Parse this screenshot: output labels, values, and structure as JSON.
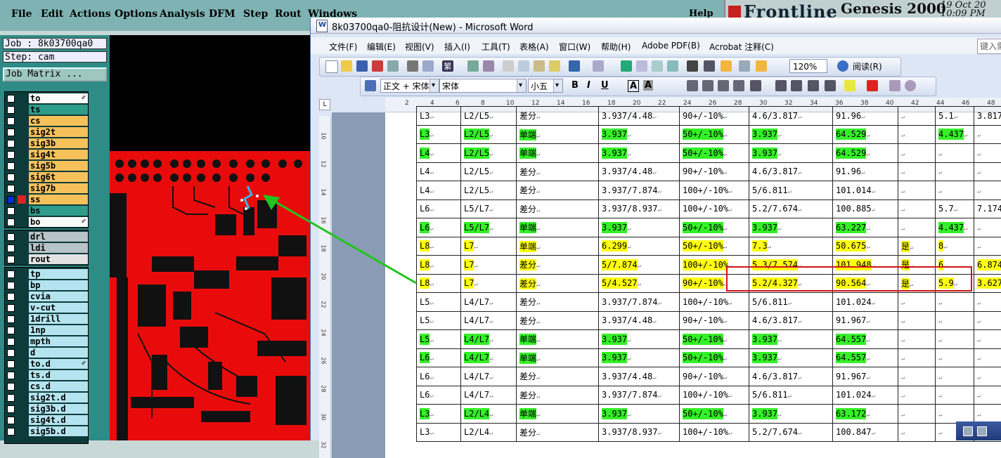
{
  "genesis": {
    "menu": [
      "File",
      "Edit",
      "Actions",
      "Options",
      "Analysis",
      "DFM",
      "Step",
      "Rout",
      "Windows"
    ],
    "help": "Help",
    "brand": "Frontline",
    "product": "Genesis 2000",
    "date_line1": "19 Oct 20",
    "date_line2": "10:09 PM",
    "job_label": "Job : 8k03700qa0",
    "step_label": "Step: cam",
    "job_matrix_button": "Job Matrix ...",
    "layers_group1": [
      {
        "name": "to",
        "color": "white",
        "mark": "brush"
      },
      {
        "name": "ts",
        "color": "teal"
      },
      {
        "name": "cs",
        "color": "orange"
      },
      {
        "name": "sig2t",
        "color": "orange"
      },
      {
        "name": "sig3b",
        "color": "orange"
      },
      {
        "name": "sig4t",
        "color": "orange"
      },
      {
        "name": "sig5b",
        "color": "orange"
      },
      {
        "name": "sig6t",
        "color": "orange"
      },
      {
        "name": "sig7b",
        "color": "orange"
      },
      {
        "name": "ss",
        "color": "orange",
        "active": true
      },
      {
        "name": "bs",
        "color": "teal"
      },
      {
        "name": "bo",
        "color": "white",
        "mark": "brush"
      }
    ],
    "layers_group2": [
      {
        "name": "drl",
        "color": "gray"
      },
      {
        "name": "ldi",
        "color": "gray"
      },
      {
        "name": "rout",
        "color": "lgray"
      }
    ],
    "layers_group3": [
      {
        "name": "tp"
      },
      {
        "name": "bp"
      },
      {
        "name": "cvia"
      },
      {
        "name": "v-cut"
      },
      {
        "name": "1drill"
      },
      {
        "name": "1np"
      },
      {
        "name": "mpth"
      },
      {
        "name": "d"
      },
      {
        "name": "to.d",
        "mark": "brush"
      },
      {
        "name": "ts.d"
      },
      {
        "name": "cs.d"
      },
      {
        "name": "sig2t.d"
      },
      {
        "name": "sig3b.d"
      },
      {
        "name": "sig4t.d"
      },
      {
        "name": "sig5b.d"
      }
    ]
  },
  "word": {
    "window_title": "8k03700qa0-阻抗设计(New) - Microsoft Word",
    "menu": [
      "文件(F)",
      "编辑(E)",
      "视图(V)",
      "插入(I)",
      "工具(T)",
      "表格(A)",
      "窗口(W)",
      "帮助(H)",
      "Adobe PDF(B)",
      "Acrobat 注释(C)"
    ],
    "ask_box": "键入需",
    "zoom": "120%",
    "read_button": "阅读(R)",
    "style_box": "正文 + 宋体",
    "font_box": "宋体",
    "size_box": "小五",
    "ruler_numbers": [
      "2",
      "4",
      "6",
      "8",
      "10",
      "12",
      "14",
      "16",
      "18",
      "20",
      "22",
      "24",
      "26",
      "28",
      "30",
      "32",
      "34",
      "36",
      "38",
      "40",
      "42",
      "44",
      "46",
      "48"
    ],
    "vruler_numbers": [
      "10",
      "12",
      "14",
      "16",
      "18",
      "20",
      "22",
      "24",
      "26",
      "28",
      "30",
      "32"
    ],
    "table_rows": [
      {
        "cells": [
          "L3",
          "L2/L5",
          "差分",
          "3.937/4.48",
          "90+/-10%",
          "4.6/3.817",
          "91.96",
          "",
          "5.1",
          "3.817"
        ],
        "hl": []
      },
      {
        "cells": [
          "L3",
          "L2/L5",
          "单端",
          "3.937",
          "50+/-10%",
          "3.937",
          "64.529",
          "",
          "4.437",
          ""
        ],
        "hl": [
          "g",
          "g",
          "g",
          "g",
          "g",
          "g",
          "g",
          "",
          "g",
          ""
        ]
      },
      {
        "cells": [
          "L4",
          "L2/L5",
          "单端",
          "3.937",
          "50+/-10%",
          "3.937",
          "64.529",
          "",
          "",
          ""
        ],
        "hl": [
          "g",
          "g",
          "g",
          "g",
          "g",
          "g",
          "g",
          "",
          "",
          ""
        ]
      },
      {
        "cells": [
          "L4",
          "L2/L5",
          "差分",
          "3.937/4.48",
          "90+/-10%",
          "4.6/3.817",
          "91.96",
          "",
          "",
          ""
        ],
        "hl": []
      },
      {
        "cells": [
          "L4",
          "L2/L5",
          "差分",
          "3.937/7.874",
          "100+/-10%",
          "5/6.811",
          "101.014",
          "",
          "",
          ""
        ],
        "hl": []
      },
      {
        "cells": [
          "L6",
          "L5/L7",
          "差分",
          "3.937/8.937",
          "100+/-10%",
          "5.2/7.674",
          "100.885",
          "",
          "5.7",
          "7.174"
        ],
        "hl": []
      },
      {
        "cells": [
          "L6",
          "L5/L7",
          "单端",
          "3.937",
          "50+/-10%",
          "3.937",
          "63.227",
          "",
          "4.437",
          ""
        ],
        "hl": [
          "g",
          "g",
          "g",
          "g",
          "g",
          "g",
          "g",
          "",
          "g",
          ""
        ]
      },
      {
        "cells": [
          "L8",
          "L7",
          "单端",
          "6.299",
          "50+/-10%",
          "7.3",
          "50.675",
          "是",
          "8",
          ""
        ],
        "hl": [
          "y",
          "y",
          "y",
          "y",
          "y",
          "y",
          "y",
          "y",
          "y",
          ""
        ]
      },
      {
        "cells": [
          "L8",
          "L7",
          "差分",
          "5/7.874",
          "100+/-10%",
          "5.3/7.574",
          "101.948",
          "是",
          "6",
          "6.874"
        ],
        "hl": [
          "y",
          "y",
          "y",
          "y",
          "y",
          "y",
          "y",
          "y",
          "y",
          "y"
        ]
      },
      {
        "cells": [
          "L8",
          "L7",
          "差分",
          "5/4.527",
          "90+/-10%",
          "5.2/4.327",
          "90.564",
          "是",
          "5.9",
          "3.627"
        ],
        "hl": [
          "y",
          "y",
          "y",
          "y",
          "y",
          "y",
          "y",
          "y",
          "y",
          "y"
        ]
      },
      {
        "cells": [
          "L5",
          "L4/L7",
          "差分",
          "3.937/7.874",
          "100+/-10%",
          "5/6.811",
          "101.024",
          "",
          "",
          ""
        ],
        "hl": []
      },
      {
        "cells": [
          "L5",
          "L4/L7",
          "差分",
          "3.937/4.48",
          "90+/-10%",
          "4.6/3.817",
          "91.967",
          "",
          "",
          ""
        ],
        "hl": []
      },
      {
        "cells": [
          "L5",
          "L4/L7",
          "单端",
          "3.937",
          "50+/-10%",
          "3.937",
          "64.557",
          "",
          "",
          ""
        ],
        "hl": [
          "g",
          "g",
          "g",
          "g",
          "g",
          "g",
          "g",
          "",
          "",
          ""
        ]
      },
      {
        "cells": [
          "L6",
          "L4/L7",
          "单端",
          "3.937",
          "50+/-10%",
          "3.937",
          "64.557",
          "",
          "",
          ""
        ],
        "hl": [
          "g",
          "g",
          "g",
          "g",
          "g",
          "g",
          "g",
          "",
          "",
          ""
        ]
      },
      {
        "cells": [
          "L6",
          "L4/L7",
          "差分",
          "3.937/4.48",
          "90+/-10%",
          "4.6/3.817",
          "91.967",
          "",
          "",
          ""
        ],
        "hl": []
      },
      {
        "cells": [
          "L6",
          "L4/L7",
          "差分",
          "3.937/7.874",
          "100+/-10%",
          "5/6.811",
          "101.024",
          "",
          "",
          ""
        ],
        "hl": []
      },
      {
        "cells": [
          "L3",
          "L2/L4",
          "单端",
          "3.937",
          "50+/-10%",
          "3.937",
          "63.172",
          "",
          "",
          ""
        ],
        "hl": [
          "g",
          "g",
          "g",
          "g",
          "g",
          "g",
          "g",
          "",
          "",
          ""
        ]
      },
      {
        "cells": [
          "L3",
          "L2/L4",
          "差分",
          "3.937/8.937",
          "100+/-10%",
          "5.2/7.674",
          "100.847",
          "",
          "",
          ""
        ],
        "hl": []
      }
    ]
  },
  "colors": {
    "green_highlight": "#35f028",
    "yellow_highlight": "#ffff10",
    "annotation_red": "#d0141a",
    "annotation_arrow": "#22c41e",
    "pcb_red": "#e90b0b"
  }
}
